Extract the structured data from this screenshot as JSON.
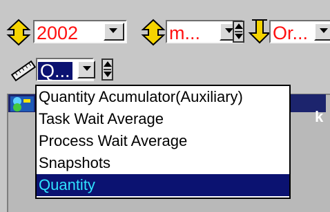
{
  "toolbar": {
    "year_combo": {
      "value": "2002",
      "icon": "double-up-down-arrow-icon"
    },
    "month_combo": {
      "value": "m...",
      "icon": "double-up-down-arrow-icon"
    },
    "order_combo": {
      "value": "Or...",
      "icon": "down-arrow-icon"
    },
    "measure_combo": {
      "value": "Q...",
      "icon": "ruler-icon"
    }
  },
  "dropdown": {
    "options": [
      {
        "label": "Quantity Acumulator(Auxiliary)"
      },
      {
        "label": "Task Wait Average"
      },
      {
        "label": "Process Wait Average"
      },
      {
        "label": "Snapshots"
      },
      {
        "label": "Quantity"
      }
    ],
    "selected_index": 4
  },
  "pane": {
    "edge_text": "k"
  },
  "colors": {
    "selection_bg": "#0b1271",
    "selection_text": "#2fe3ff",
    "combo_text": "#ff1010",
    "icon_yellow": "#f5d400"
  }
}
